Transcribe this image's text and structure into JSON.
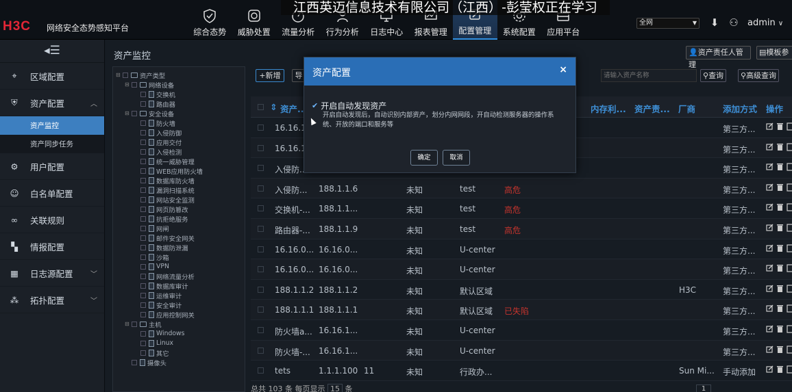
{
  "header": {
    "logo": "H3C",
    "platform": "网络安全态势感知平台",
    "nav": [
      {
        "label": "综合态势",
        "icon": "shield-icon"
      },
      {
        "label": "威胁处置",
        "icon": "clock-icon"
      },
      {
        "label": "流量分析",
        "icon": "gauge-icon"
      },
      {
        "label": "行为分析",
        "icon": "person-icon"
      },
      {
        "label": "日志中心",
        "icon": "monitor-icon"
      },
      {
        "label": "报表管理",
        "icon": "chart-icon"
      },
      {
        "label": "配置管理",
        "icon": "config-icon",
        "active": true
      },
      {
        "label": "系统配置",
        "icon": "gear-icon"
      },
      {
        "label": "应用平台",
        "icon": "briefcase-icon"
      }
    ],
    "watermark": "江西英迈信息技术有限公司（江西）-彭莹权正在学习",
    "scope_select": "全网",
    "user": "admin"
  },
  "sidebar": {
    "items": [
      {
        "label": "区域配置",
        "icon": "location-icon"
      },
      {
        "label": "资产配置",
        "icon": "shield-check-icon",
        "expanded": true
      },
      {
        "label": "用户配置",
        "icon": "user-gear-icon"
      },
      {
        "label": "白名单配置",
        "icon": "user-list-icon"
      },
      {
        "label": "关联规则",
        "icon": "link-icon"
      },
      {
        "label": "情报配置",
        "icon": "intel-icon"
      },
      {
        "label": "日志源配置",
        "icon": "log-source-icon"
      },
      {
        "label": "拓扑配置",
        "icon": "topology-icon"
      }
    ],
    "sub_items": [
      "资产监控",
      "资产同步任务"
    ]
  },
  "main": {
    "title": "资产监控",
    "buttons": {
      "owner_mgmt": "资产责任人管理",
      "template_mgmt": "模板参",
      "add": "+新增",
      "import": "导",
      "query": "查询",
      "advanced_query": "高级查询"
    },
    "search_placeholder": "请输入资产名称",
    "tree": [
      {
        "label": "资产类型",
        "level": 0,
        "kind": "folder"
      },
      {
        "label": "网络设备",
        "level": 1,
        "kind": "folder"
      },
      {
        "label": "交换机",
        "level": 2,
        "kind": "doc"
      },
      {
        "label": "路由器",
        "level": 2,
        "kind": "doc"
      },
      {
        "label": "安全设备",
        "level": 1,
        "kind": "folder"
      },
      {
        "label": "防火墙",
        "level": 2,
        "kind": "doc"
      },
      {
        "label": "入侵防御",
        "level": 2,
        "kind": "doc"
      },
      {
        "label": "应用交付",
        "level": 2,
        "kind": "doc"
      },
      {
        "label": "入侵检测",
        "level": 2,
        "kind": "doc"
      },
      {
        "label": "统一威胁管理",
        "level": 2,
        "kind": "doc"
      },
      {
        "label": "WEB应用防火墙",
        "level": 2,
        "kind": "doc"
      },
      {
        "label": "数据库防火墙",
        "level": 2,
        "kind": "doc"
      },
      {
        "label": "漏洞扫描系统",
        "level": 2,
        "kind": "doc"
      },
      {
        "label": "网站安全监测",
        "level": 2,
        "kind": "doc"
      },
      {
        "label": "网页防篡改",
        "level": 2,
        "kind": "doc"
      },
      {
        "label": "抗拒绝服务",
        "level": 2,
        "kind": "doc"
      },
      {
        "label": "网闸",
        "level": 2,
        "kind": "doc"
      },
      {
        "label": "邮件安全网关",
        "level": 2,
        "kind": "doc"
      },
      {
        "label": "数据防泄漏",
        "level": 2,
        "kind": "doc"
      },
      {
        "label": "沙箱",
        "level": 2,
        "kind": "doc"
      },
      {
        "label": "VPN",
        "level": 2,
        "kind": "doc"
      },
      {
        "label": "网络流量分析",
        "level": 2,
        "kind": "doc"
      },
      {
        "label": "数据库审计",
        "level": 2,
        "kind": "doc"
      },
      {
        "label": "运维审计",
        "level": 2,
        "kind": "doc"
      },
      {
        "label": "安全审计",
        "level": 2,
        "kind": "doc"
      },
      {
        "label": "应用控制网关",
        "level": 2,
        "kind": "doc"
      },
      {
        "label": "主机",
        "level": 1,
        "kind": "folder"
      },
      {
        "label": "Windows",
        "level": 2,
        "kind": "doc"
      },
      {
        "label": "Linux",
        "level": 2,
        "kind": "doc"
      },
      {
        "label": "其它",
        "level": 2,
        "kind": "doc"
      },
      {
        "label": "摄像头",
        "level": 1,
        "kind": "doc"
      }
    ],
    "columns": [
      "资产...",
      "内存利...",
      "资产责...",
      "厂商",
      "添加方式",
      "操作"
    ],
    "rows": [
      [
        "16.16.1",
        "",
        "",
        "",
        "",
        "",
        "",
        "第三方..."
      ],
      [
        "16.16.1",
        "",
        "",
        "",
        "",
        "",
        "",
        "第三方..."
      ],
      [
        "入侵防...",
        "",
        "",
        "",
        "",
        "",
        "",
        "第三方..."
      ],
      [
        "入侵防...",
        "188.1.1.6",
        "",
        "未知",
        "test",
        "高危",
        "",
        "第三方..."
      ],
      [
        "交换机-...",
        "188.1.1...",
        "",
        "未知",
        "test",
        "高危",
        "",
        "第三方..."
      ],
      [
        "路由器-...",
        "188.1.1.9",
        "",
        "未知",
        "test",
        "高危",
        "",
        "第三方..."
      ],
      [
        "16.16.0...",
        "16.16.0...",
        "",
        "未知",
        "U-center",
        "",
        "",
        "第三方..."
      ],
      [
        "16.16.0...",
        "16.16.0...",
        "",
        "未知",
        "U-center",
        "",
        "",
        "第三方..."
      ],
      [
        "188.1.1.2",
        "188.1.1.2",
        "",
        "未知",
        "默认区域",
        "",
        "H3C",
        "第三方..."
      ],
      [
        "188.1.1.1",
        "188.1.1.1",
        "",
        "未知",
        "默认区域",
        "已失陷",
        "",
        "第三方..."
      ],
      [
        "防火墙a...",
        "16.16.1...",
        "",
        "未知",
        "U-center",
        "",
        "",
        "第三方..."
      ],
      [
        "防火墙-...",
        "16.16.1...",
        "",
        "未知",
        "U-center",
        "",
        "",
        "第三方..."
      ],
      [
        "tets",
        "1.1.1.100",
        "11",
        "未知",
        "行政办...",
        "",
        "Sun Mi...",
        "手动添加"
      ]
    ],
    "footer": "总共 103 条 每页显示",
    "page_size": "15",
    "footer_suffix": "条",
    "current_page": "1"
  },
  "modal": {
    "title": "资产配置",
    "option_label": "开启自动发现资产",
    "description": "开启自动发现后，自动识别内部资产，划分内网网段，开自动检测服务器的操作系统、开放的端口和服务等",
    "confirm": "确定",
    "cancel": "取消",
    "close": "×"
  }
}
